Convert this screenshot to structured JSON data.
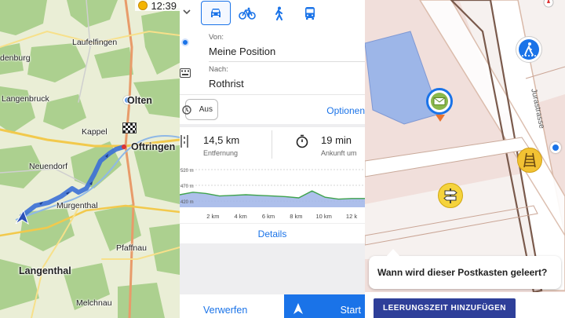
{
  "status_bar": {
    "time": "12:39",
    "icon": "alarm-icon"
  },
  "map_overview": {
    "towns": [
      {
        "name": "Laufelfingen"
      },
      {
        "name": "denburg"
      },
      {
        "name": "Langenbruck"
      },
      {
        "name": "Olten"
      },
      {
        "name": "Kappel"
      },
      {
        "name": "Oftringen"
      },
      {
        "name": "Neuendorf"
      },
      {
        "name": "Murgenthal"
      },
      {
        "name": "Pfaffnau"
      },
      {
        "name": "Langenthal"
      },
      {
        "name": "Melchnau"
      }
    ],
    "route_color": "#3b6fd6"
  },
  "route_planner": {
    "modes": [
      {
        "name": "car-icon",
        "selected": true
      },
      {
        "name": "bicycle-icon",
        "selected": false
      },
      {
        "name": "walk-icon",
        "selected": false
      },
      {
        "name": "bus-icon",
        "selected": false
      }
    ],
    "from_label": "Von:",
    "from_value": "Meine Position",
    "to_label": "Nach:",
    "to_value": "Rothrist",
    "toggle_label": "Aus",
    "options_label": "Optionen",
    "distance_value": "14,5 km",
    "distance_label": "Entfernung",
    "time_value": "19 min",
    "time_label": "Ankunft um",
    "details_label": "Details",
    "discard_label": "Verwerfen",
    "start_label": "Start",
    "accent": "#1a73e8"
  },
  "elevation_chart": {
    "y_ticks": [
      "520 m",
      "470 m",
      "420 m"
    ],
    "x_ticks": [
      "2 km",
      "4 km",
      "6 km",
      "8 km",
      "10 km",
      "12 k"
    ]
  },
  "chart_data": {
    "type": "area",
    "xlabel": "",
    "ylabel": "",
    "x": [
      0,
      1,
      2,
      3,
      4,
      5,
      6,
      7,
      8,
      9,
      10,
      11,
      12,
      13,
      14
    ],
    "values": [
      440,
      448,
      444,
      436,
      438,
      440,
      438,
      436,
      434,
      430,
      452,
      432,
      426,
      428,
      428
    ],
    "ylim": [
      400,
      530
    ],
    "grid": false
  },
  "poi_map": {
    "street_name": "Jurastrasse",
    "question": "Wann wird dieser Postkasten geleert?",
    "action_button": "LEERUNGSZEIT HINZUFÜGEN",
    "button_color": "#2e3f99"
  }
}
